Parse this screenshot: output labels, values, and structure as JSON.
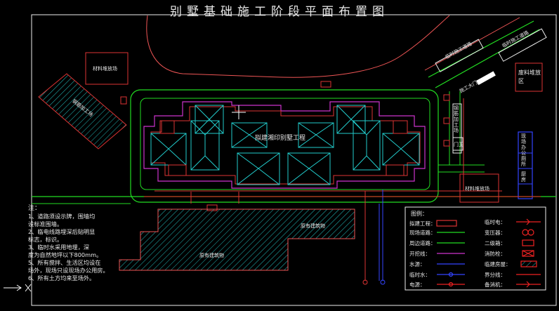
{
  "title": "别墅基础施工阶段平面布置图",
  "labels": {
    "material_yard_top": "材料堆放场",
    "material_yard_right": "材料堆放场",
    "storage_left": "钢筋加工场",
    "building": "拟建湘印别墅工程",
    "existing_bldg_1": "原有建筑物",
    "existing_bldg_2": "原有建筑物",
    "waste_area": "废料堆放区",
    "gate": "施工大门",
    "road_sign_1": "临时施工道路",
    "road_sign_2": "临时施工道路",
    "guard": "门卫",
    "office_1": "现场办公",
    "office_2": "厕所",
    "office_3": "厨房",
    "site_strip": "钢筋加工场"
  },
  "notes": {
    "heading": "注：",
    "lines": [
      "1、道路须设示牌，围墙均",
      "   设标准围墙。",
      "2、临电线路埋深后贴明显",
      "   标志，标识。",
      "3、临时水采用地埋，深",
      "   度为自然地坪以下800mm。",
      "5、所有搅拌、生活区均设在",
      "   场外，现场只设现场办公用房。",
      "6、所有土方均来至场外。"
    ]
  },
  "legend": {
    "title": "图例：",
    "left": [
      {
        "label": "拟建工程：",
        "symbol": "rect-red"
      },
      {
        "label": "现场道路：",
        "symbol": "line-green"
      },
      {
        "label": "周边道路：",
        "symbol": "line-green"
      },
      {
        "label": "开挖线：",
        "symbol": "line-magenta"
      },
      {
        "label": "水源：",
        "symbol": "line-blue"
      },
      {
        "label": "临时水：",
        "symbol": "line-blue-dot"
      },
      {
        "label": "电源：",
        "symbol": "line-red-dot"
      }
    ],
    "right": [
      {
        "label": "临时电：",
        "symbol": "line-red-arrow"
      },
      {
        "label": "变压器：",
        "symbol": "transformer"
      },
      {
        "label": "二级箱：",
        "symbol": "box-red"
      },
      {
        "label": "消防栓：",
        "symbol": "box-red-x"
      },
      {
        "label": "临建房屋：",
        "symbol": "rect-hatch"
      },
      {
        "label": "界分线：",
        "symbol": "line-red-thin"
      },
      {
        "label": "备消机：",
        "symbol": "line-red-arrow"
      }
    ]
  },
  "colors": {
    "background": "#000000",
    "text": "#e8e8e8",
    "road": "#22dd22",
    "excavation": "#cc33cc",
    "building": "#dd3333",
    "roof": "#22cccc",
    "water": "#3344ff",
    "power": "#ee2222",
    "hatch": "#22bbbb",
    "frame": "#eeeeee"
  }
}
